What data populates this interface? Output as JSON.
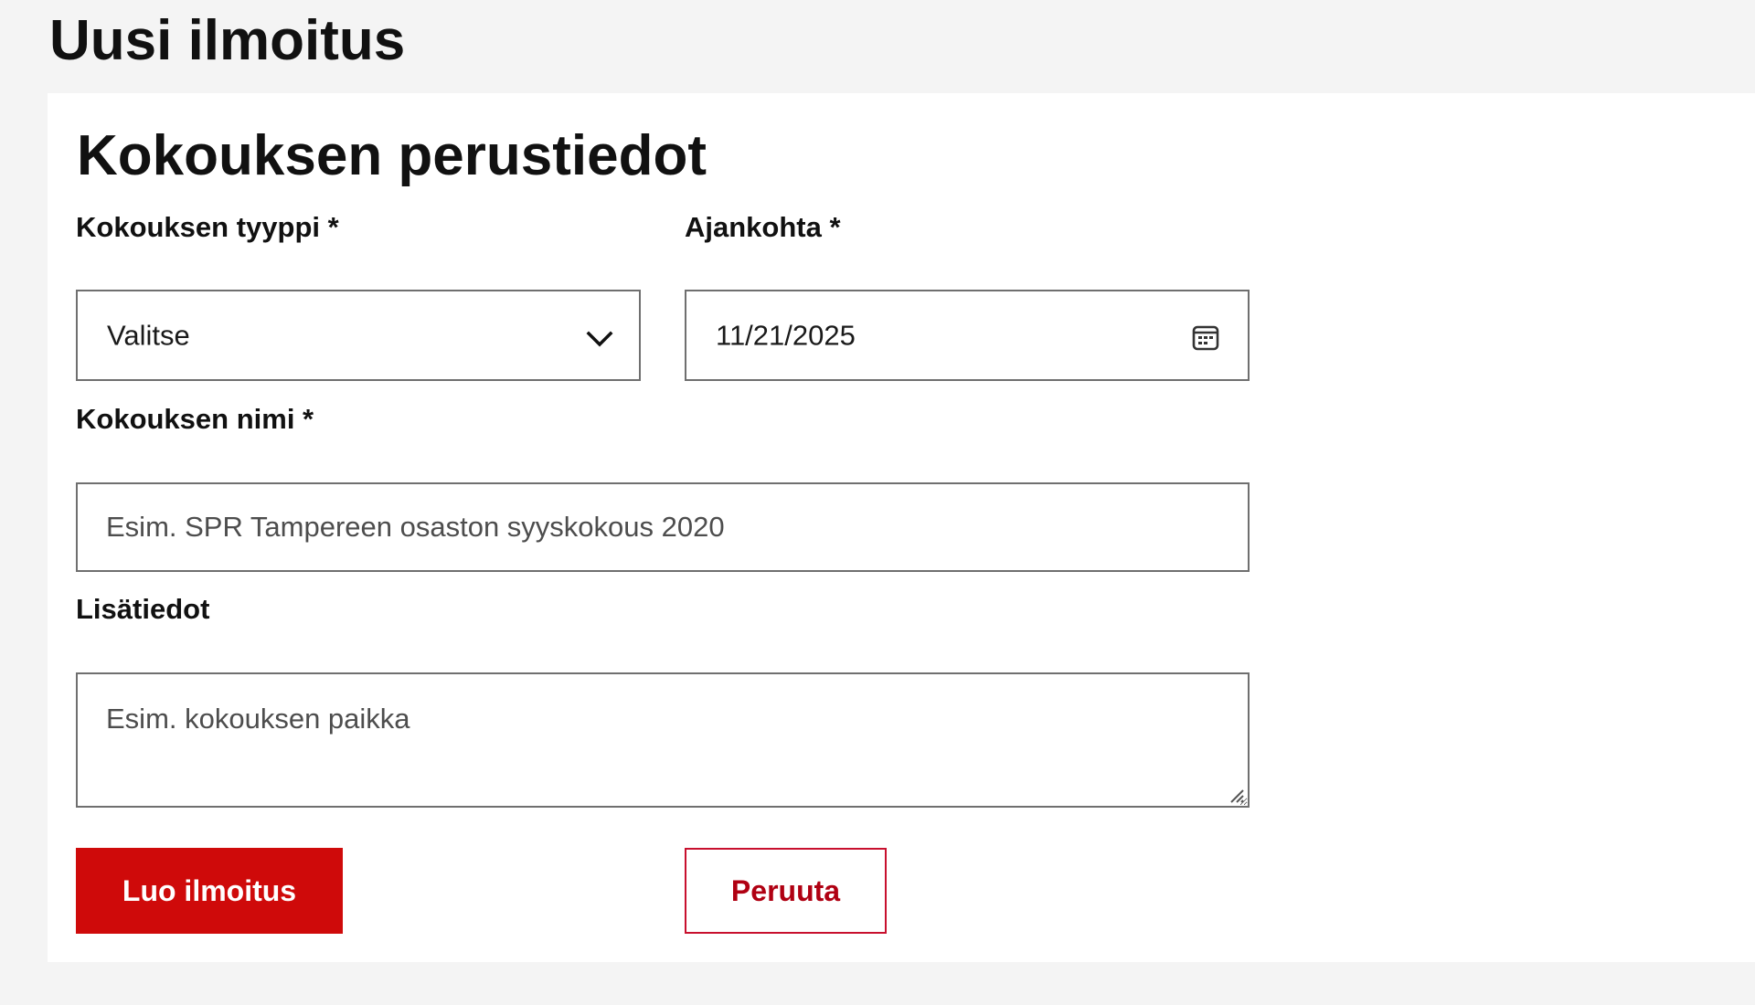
{
  "page": {
    "title": "Uusi ilmoitus"
  },
  "form": {
    "section_title": "Kokouksen perustiedot",
    "meeting_type": {
      "label": "Kokouksen tyyppi *",
      "value": "Valitse",
      "icon": "chevron-down-icon"
    },
    "date": {
      "label": "Ajankohta *",
      "value": "11/21/2025",
      "icon": "calendar-icon"
    },
    "meeting_name": {
      "label": "Kokouksen nimi *",
      "placeholder": "Esim. SPR Tampereen osaston syyskokous 2020"
    },
    "additional_info": {
      "label": "Lisätiedot",
      "placeholder": "Esim. kokouksen paikka",
      "resize_icon": "resize-handle-icon"
    }
  },
  "actions": {
    "create_label": "Luo ilmoitus",
    "cancel_label": "Peruuta"
  },
  "colors": {
    "primary": "#cf0a0a",
    "secondary_text": "#b00012",
    "border": "#6f6f6f",
    "background": "#f4f4f4",
    "card": "#ffffff"
  }
}
